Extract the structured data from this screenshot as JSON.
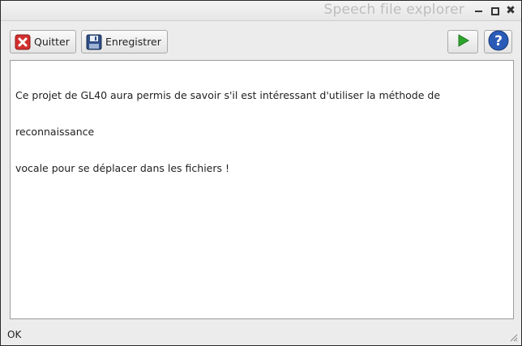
{
  "window": {
    "title": "Speech file explorer",
    "controls": {
      "minimize": "minimize-icon",
      "maximize": "maximize-icon",
      "close": "✖"
    }
  },
  "toolbar": {
    "quit_label": "Quitter",
    "save_label": "Enregistrer",
    "quit_icon": "close-red-icon",
    "save_icon": "floppy-disk-icon",
    "play_icon": "play-icon",
    "help_icon": "help-icon"
  },
  "editor": {
    "lines": [
      "Ce projet de GL40 aura permis de savoir s'il est intéressant d'utiliser la méthode de",
      "reconnaissance",
      "vocale pour se déplacer dans les fichiers !"
    ]
  },
  "status": {
    "text": "OK"
  },
  "colors": {
    "play_green": "#2ea52e",
    "help_blue": "#2a5bb7",
    "quit_red": "#d32f2f",
    "title_text": "#bdbdbd"
  }
}
